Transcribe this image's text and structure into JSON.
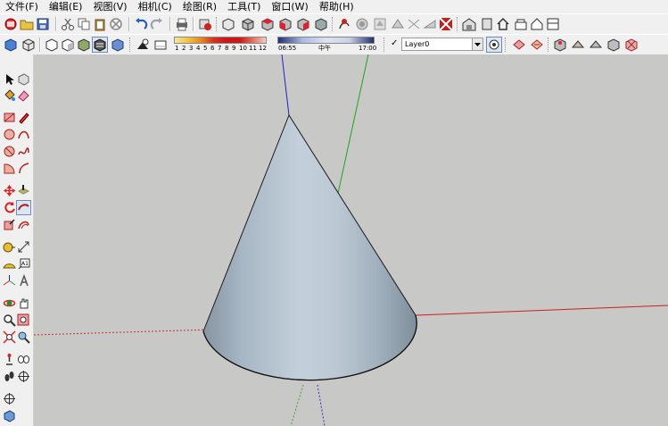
{
  "menu": [
    "文件(F)",
    "编辑(E)",
    "视图(V)",
    "相机(C)",
    "绘图(R)",
    "工具(T)",
    "窗口(W)",
    "帮助(H)"
  ],
  "shadow": {
    "month_ticks": [
      "1",
      "2",
      "3",
      "4",
      "5",
      "6",
      "7",
      "8",
      "9",
      "10",
      "11",
      "12"
    ],
    "time_start": "06:55",
    "time_mid": "中午",
    "time_end": "17:00"
  },
  "layers": {
    "checkmark": "✓",
    "current_layer": "Layer0"
  },
  "colors": {
    "viewport_bg": "#c8c8c6",
    "cone_light": "#c2d0dc",
    "cone_dark": "#7d8e9c",
    "axis_red": "#cc1f1f",
    "axis_green": "#1fa31f",
    "axis_blue": "#1f1fcc"
  }
}
